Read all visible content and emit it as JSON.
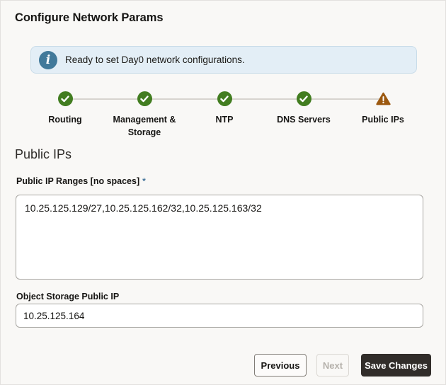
{
  "page": {
    "title": "Configure Network Params"
  },
  "banner": {
    "icon": "info-icon",
    "message": "Ready to set Day0 network configurations."
  },
  "stepper": {
    "steps": [
      {
        "label": "Routing",
        "status": "complete",
        "icon": "check-circle-icon"
      },
      {
        "label": "Management & Storage",
        "status": "complete",
        "icon": "check-circle-icon"
      },
      {
        "label": "NTP",
        "status": "complete",
        "icon": "check-circle-icon"
      },
      {
        "label": "DNS Servers",
        "status": "complete",
        "icon": "check-circle-icon"
      },
      {
        "label": "Public IPs",
        "status": "warning",
        "icon": "warning-triangle-icon"
      }
    ]
  },
  "section": {
    "heading": "Public IPs"
  },
  "form": {
    "ip_ranges": {
      "label": "Public IP Ranges [no spaces]",
      "required_marker": "*",
      "value": "10.25.125.129/27,10.25.125.162/32,10.25.125.163/32"
    },
    "object_storage": {
      "label": "Object Storage Public IP",
      "value": "10.25.125.164"
    }
  },
  "actions": {
    "previous": "Previous",
    "next": "Next",
    "save": "Save Changes"
  },
  "colors": {
    "success_green": "#427d20",
    "warning_brown": "#9c5910",
    "info_blue": "#41799a",
    "banner_bg": "#e3eef6",
    "primary_button_bg": "#312d2a",
    "page_bg": "#f9f8f6"
  }
}
